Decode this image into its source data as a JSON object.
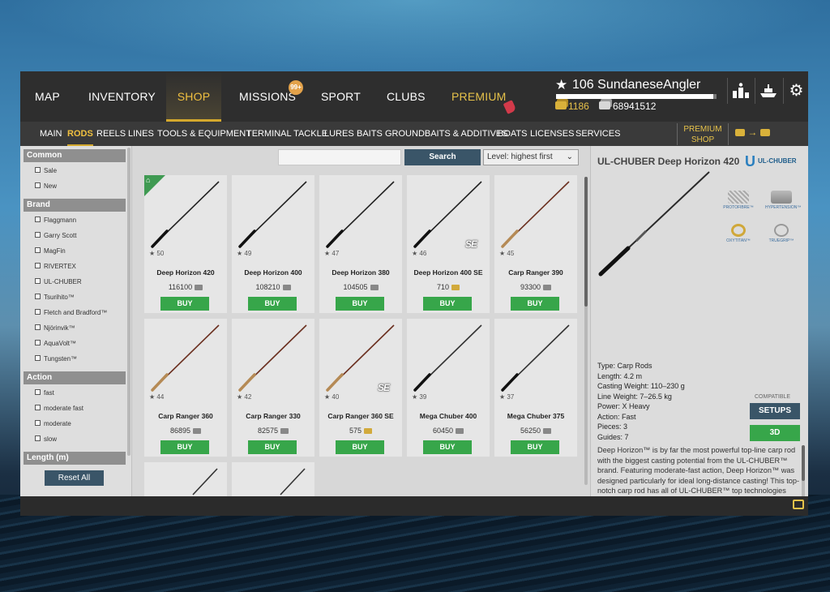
{
  "colors": {
    "accent": "#d4a82c",
    "buy": "#37a64a",
    "button": "#3a5568",
    "topbar": "#2e2e2e"
  },
  "topnav": {
    "items": [
      "MAP",
      "INVENTORY",
      "SHOP",
      "MISSIONS",
      "SPORT",
      "CLUBS",
      "PREMIUM"
    ],
    "missions_badge": "99+"
  },
  "player": {
    "level": "106",
    "name": "SundaneseAngler",
    "xp_progress": 0.98,
    "gold": "1186",
    "silver": "68941512"
  },
  "top_icons": [
    "leaderboard-icon",
    "ship-icon",
    "gear-icon"
  ],
  "subnav": {
    "items": [
      "MAIN",
      "RODS",
      "REELS",
      "LINES",
      "TOOLS & EQUIPMENT",
      "TERMINAL TACKLE",
      "LURES",
      "BAITS",
      "GROUNDBAITS & ADDITIVES",
      "BOATS",
      "LICENSES",
      "SERVICES"
    ],
    "premium_shop": "PREMIUM SHOP",
    "exchange_arrow": "→"
  },
  "sidebar": {
    "groups": [
      {
        "title": "Common",
        "items": [
          "Sale",
          "New"
        ]
      },
      {
        "title": "Brand",
        "items": [
          "Flaggmann",
          "Garry Scott",
          "MagFin",
          "RIVERTEX",
          "UL-CHUBER",
          "Tsurihito™",
          "Fletch and Bradford™",
          "Njörinvik™",
          "AquaVolt™",
          "Tungsten™"
        ]
      },
      {
        "title": "Action",
        "items": [
          "fast",
          "moderate fast",
          "moderate",
          "slow"
        ]
      },
      {
        "title": "Length (m)",
        "items": []
      }
    ],
    "reset_label": "Reset All"
  },
  "search": {
    "placeholder": "",
    "button": "Search"
  },
  "sort": {
    "selected": "Level: highest first"
  },
  "buy_label": "BUY",
  "products": [
    {
      "level": "50",
      "name": "Deep Horizon 420",
      "price": "116100",
      "currency": "silver",
      "color": "#222",
      "se": "",
      "home": true
    },
    {
      "level": "49",
      "name": "Deep Horizon 400",
      "price": "108210",
      "currency": "silver",
      "color": "#222",
      "se": ""
    },
    {
      "level": "47",
      "name": "Deep Horizon 380",
      "price": "104505",
      "currency": "silver",
      "color": "#222",
      "se": ""
    },
    {
      "level": "46",
      "name": "Deep Horizon 400 SE",
      "price": "710",
      "currency": "gold",
      "color": "#222",
      "se": "SE"
    },
    {
      "level": "45",
      "name": "Carp Ranger 390",
      "price": "93300",
      "currency": "silver",
      "color": "#6b3020",
      "se": ""
    },
    {
      "level": "44",
      "name": "Carp Ranger 360",
      "price": "86895",
      "currency": "silver",
      "color": "#6b3020",
      "se": ""
    },
    {
      "level": "42",
      "name": "Carp Ranger 330",
      "price": "82575",
      "currency": "silver",
      "color": "#6b3020",
      "se": ""
    },
    {
      "level": "40",
      "name": "Carp Ranger 360 SE",
      "price": "575",
      "currency": "gold",
      "color": "#6b3020",
      "se": "SE"
    },
    {
      "level": "39",
      "name": "Mega Chuber 400",
      "price": "60450",
      "currency": "silver",
      "color": "#333",
      "se": ""
    },
    {
      "level": "37",
      "name": "Mega Chuber 375",
      "price": "56250",
      "currency": "silver",
      "color": "#333",
      "se": ""
    },
    {
      "level": "",
      "name": "",
      "price": "",
      "currency": "",
      "color": "#333",
      "se": "",
      "partial": true
    },
    {
      "level": "",
      "name": "",
      "price": "",
      "currency": "",
      "color": "#333",
      "se": "",
      "partial": true
    }
  ],
  "detail": {
    "title": "UL-CHUBER Deep Horizon 420",
    "brand_logo": "UL-CHUBER",
    "tech": [
      "PROTOFIBRE™",
      "HYPERTENSION™",
      "OXYTITAN™",
      "TRUEGRIP™"
    ],
    "specs": [
      "Type: Carp Rods",
      "Length: 4.2 m",
      "Casting Weight: 110–230 g",
      "Line Weight: 7–26.5 kg",
      "Power: X Heavy",
      "Action: Fast",
      "Pieces: 3",
      "Guides: 7"
    ],
    "compatible_label": "COMPATIBLE",
    "setups_label": "SETUPS",
    "view3d_label": "3D",
    "description": "Deep Horizon™ is by far the most powerful top-line carp rod with the biggest casting potential from the UL-CHUBER™ brand. Featuring moderate-fast action, Deep Horizon™ was designed particularly for ideal long-distance casting! This top-notch carp rod has all of UL-CHUBER™ top technologies woven into its very core, including the state-of-the-art ProtoFibre™ material and the HyperTension™ high frequency curing method used for blank creation, making this carp rod able to withstand extreme pressure loads. Deep Horizon™ is equipped with the highest grade OxyTitan™ guides as"
  }
}
